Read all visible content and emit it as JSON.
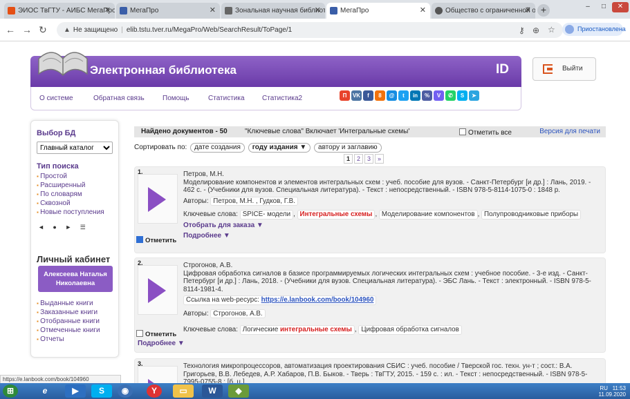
{
  "browser": {
    "tabs": [
      {
        "label": "ЭИОС ТвГТУ - АИБС МегаПро",
        "favcolor": "#e54f14"
      },
      {
        "label": "МегаПро",
        "favcolor": "#3a5ea8"
      },
      {
        "label": "Зональная научная библиотека",
        "favcolor": "#666"
      },
      {
        "label": "МегаПро",
        "favcolor": "#3a5ea8"
      },
      {
        "label": "Общество с ограниченной отв",
        "favcolor": "#555"
      }
    ],
    "warning": "Не защищено",
    "url": "elib.tstu.tver.ru/MegaPro/Web/SearchResult/ToPage/1",
    "profile": "Приостановлена"
  },
  "header": {
    "title": "Электронная библиотека",
    "logo_mark": "ID",
    "exit_label": "Выйти"
  },
  "menu": [
    "О системе",
    "Обратная связь",
    "Помощь",
    "Статистика",
    "Статистика2"
  ],
  "social": [
    {
      "t": "П",
      "c": "#e8432b"
    },
    {
      "t": "VK",
      "c": "#4c75a3"
    },
    {
      "t": "f",
      "c": "#3b5998"
    },
    {
      "t": "8",
      "c": "#f2720c"
    },
    {
      "t": "@",
      "c": "#168de2"
    },
    {
      "t": "t",
      "c": "#1da1f2"
    },
    {
      "t": "in",
      "c": "#0077b5"
    },
    {
      "t": "%",
      "c": "#4d5da3"
    },
    {
      "t": "V",
      "c": "#7360f2"
    },
    {
      "t": "✆",
      "c": "#25d366"
    },
    {
      "t": "S",
      "c": "#00aff0"
    },
    {
      "t": "➤",
      "c": "#2ca5e0"
    }
  ],
  "sidebar": {
    "db_heading": "Выбор БД",
    "db_selected": "Главный каталог",
    "search_heading": "Тип поиска",
    "search_types": [
      "Простой",
      "Расширенный",
      "По словарям",
      "Сквозной",
      "Новые поступления"
    ],
    "controls": "◄ ● ► ☰",
    "cabinet_heading": "Личный кабинет",
    "user_name": "Алексеева Наталья Николаевна",
    "cabinet_links": [
      "Выданные книги",
      "Заказанные книги",
      "Отобранные книги",
      "Отмеченные книги",
      "Отчеты"
    ]
  },
  "results": {
    "found": "Найдено документов - 50",
    "query": "\"Ключевые слова\" Включает 'Интегральные схемы'",
    "mark_all": "Отметить все",
    "print": "Версия для печати",
    "sort_label": "Сортировать по:",
    "sort_opts": [
      "дате создания",
      "году издания ▼",
      "автору и заглавию"
    ],
    "pages": [
      "1",
      "2",
      "3",
      "»"
    ]
  },
  "records": [
    {
      "num": "1.",
      "author": "Петров, М.Н.",
      "desc": "Моделирование компонентов и элементов интегральных схем : учеб. пособие для вузов. - Санкт-Петербург [и др.] : Лань, 2019. - 462 с. - (Учебники для вузов. Специальная литература). - Текст : непосредственный. - ISBN 978-5-8114-1075-0 : 1848 р.",
      "authors_label": "Авторы:",
      "authors": "Петров, М.Н. , Гудков, Г.В.",
      "kw_label": "Ключевые слова:",
      "kw": [
        "SPICE- модели",
        "Интегральные схемы",
        "Моделирование компонентов",
        "Полупроводниковые приборы"
      ],
      "order": "Отобрать для заказа ▼",
      "more": "Подробнее ▼",
      "mark": "Отметить"
    },
    {
      "num": "2.",
      "author": "Строгонов, А.В.",
      "desc": "Цифровая обработка сигналов в базисе программируемых логических интегральных схем : учебное пособие. - 3-е изд. - Санкт-Петербург [и др.] : Лань, 2018. - (Учебники для вузов. Специальная литература). - ЭБС Лань. - Текст : электронный. - ISBN 978-5-8114-1981-4.",
      "link_label": "Ссылка на web-ресурс:",
      "link": "https://e.lanbook.com/book/104960",
      "authors_label": "Авторы:",
      "authors": "Строгонов, А.В.",
      "kw_label": "Ключевые слова:",
      "kw_a": "Логические",
      "kw_b": "интегральные схемы",
      "kw_c": "Цифровая обработка сигналов",
      "more": "Подробнее ▼",
      "mark": "Отметить"
    },
    {
      "num": "3.",
      "desc": "Технология микропроцессоров, автоматизация проектирования СБИС : учеб. пособие / Тверской гос. техн. ун-т ; сост.: В.А. Григорьев, В.В. Лебедев, А.Р. Хабаров, П.В. Быков. - Тверь : ТвГТУ, 2015. - 159 с. : ил. - Текст : непосредственный. - ISBN 978-5-7995-0755-8 : [б. ц.]."
    }
  ],
  "status_url": "https://e.lanbook.com/book/104960",
  "clock": {
    "time": "11:53",
    "date": "11.09.2020",
    "lang": "RU"
  }
}
